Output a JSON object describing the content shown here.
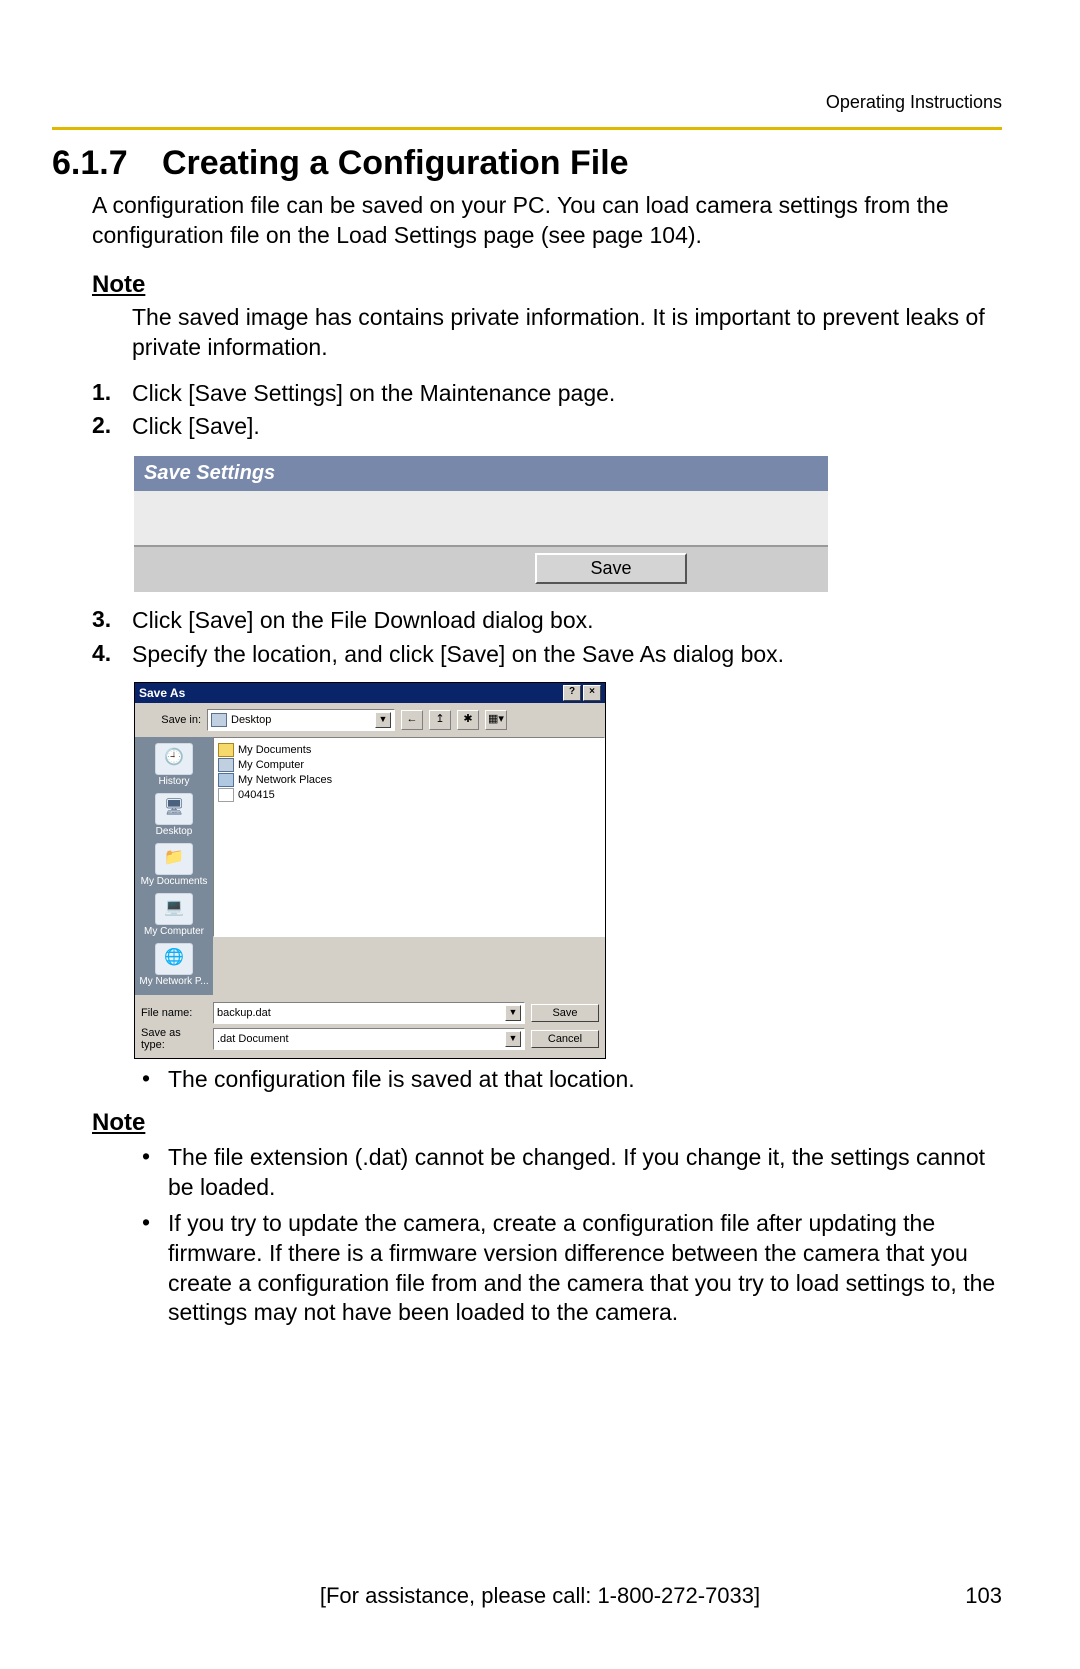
{
  "header": {
    "doc_title": "Operating Instructions"
  },
  "section": {
    "number": "6.1.7",
    "title": "Creating a Configuration File",
    "intro": "A configuration file can be saved on your PC. You can load camera settings from the configuration file on the Load Settings page (see page 104)."
  },
  "note1": {
    "label": "Note",
    "body": "The saved image has contains private information. It is important to prevent leaks of private information."
  },
  "steps": {
    "s1": {
      "n": "1.",
      "t": "Click [Save Settings] on the Maintenance page."
    },
    "s2": {
      "n": "2.",
      "t": "Click [Save]."
    },
    "s3": {
      "n": "3.",
      "t": "Click [Save] on the File Download dialog box."
    },
    "s4": {
      "n": "4.",
      "t": "Specify the location, and click [Save] on the Save As dialog box."
    }
  },
  "save_settings_panel": {
    "title": "Save Settings",
    "button": "Save"
  },
  "saveas": {
    "title": "Save As",
    "savein_label": "Save in:",
    "savein_value": "Desktop",
    "toolbar": {
      "back": "←",
      "up": "↥",
      "new": "✱",
      "view": "▦▾"
    },
    "sidebar": {
      "history": "History",
      "desktop": "Desktop",
      "mydocs": "My Documents",
      "mycomp": "My Computer",
      "mynet": "My Network P..."
    },
    "files": {
      "f1": "My Documents",
      "f2": "My Computer",
      "f3": "My Network Places",
      "f4": "040415"
    },
    "filename_label": "File name:",
    "filename_value": "backup.dat",
    "filetype_label": "Save as type:",
    "filetype_value": ".dat Document",
    "save_btn": "Save",
    "cancel_btn": "Cancel"
  },
  "after_saveas_bullet": "The configuration file is saved at that location.",
  "note2": {
    "label": "Note",
    "b1": "The file extension (.dat) cannot be changed. If you change it, the settings cannot be loaded.",
    "b2": "If you try to update the camera, create a configuration file after updating the firmware. If there is a firmware version difference between the camera that you create a configuration file from and the camera that you try to load settings to, the settings may not have been loaded to the camera."
  },
  "footer": {
    "assist": "[For assistance, please call: 1-800-272-7033]",
    "page": "103"
  }
}
